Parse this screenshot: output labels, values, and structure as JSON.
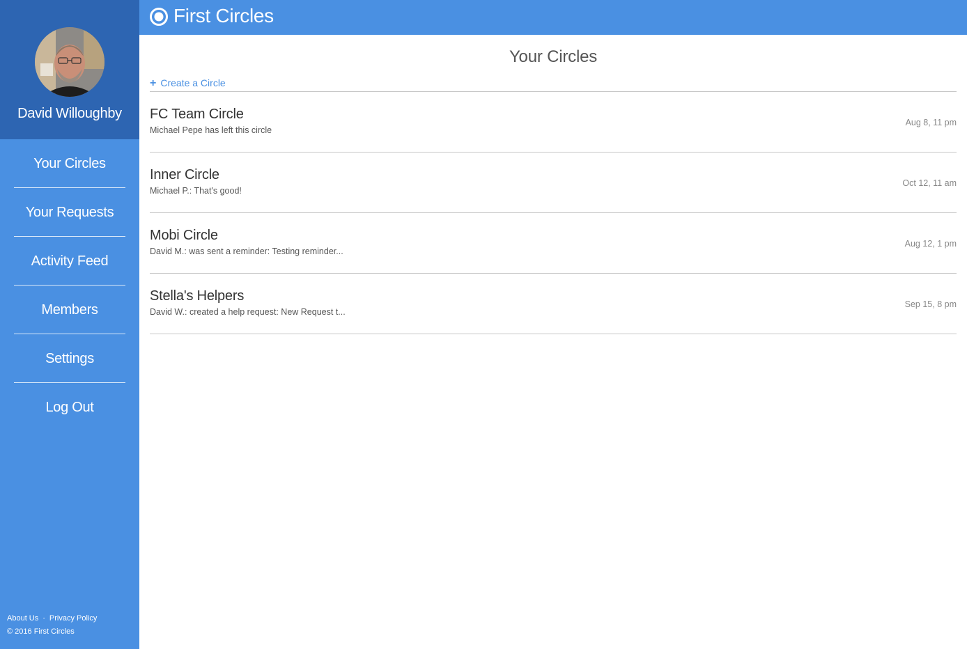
{
  "app": {
    "title": "First Circles"
  },
  "profile": {
    "name": "David Willoughby"
  },
  "nav": {
    "items": [
      {
        "label": "Your Circles"
      },
      {
        "label": "Your Requests"
      },
      {
        "label": "Activity Feed"
      },
      {
        "label": "Members"
      },
      {
        "label": "Settings"
      },
      {
        "label": "Log Out"
      }
    ]
  },
  "footer": {
    "about": "About Us",
    "separator": "·",
    "privacy": "Privacy Policy",
    "copyright": "© 2016 First Circles"
  },
  "main": {
    "title": "Your Circles",
    "create_label": "Create a Circle",
    "circles": [
      {
        "name": "FC Team Circle",
        "subtitle": "Michael Pepe has left this circle",
        "date": "Aug 8, 11 pm"
      },
      {
        "name": "Inner Circle",
        "subtitle": "Michael P.: That's good!",
        "date": "Oct 12, 11 am"
      },
      {
        "name": "Mobi Circle",
        "subtitle": "David M.: was sent a reminder: Testing reminder...",
        "date": "Aug 12, 1 pm"
      },
      {
        "name": "Stella's Helpers",
        "subtitle": "David W.: created a help request: New Request t...",
        "date": "Sep 15, 8 pm"
      }
    ]
  },
  "colors": {
    "primary": "#4a90e2",
    "profile_bg": "#2d65b2",
    "divider": "#c7c7c7"
  },
  "icons": {
    "logo": "circle-logo-icon",
    "create": "plus-icon",
    "avatar": "user-avatar-photo"
  }
}
